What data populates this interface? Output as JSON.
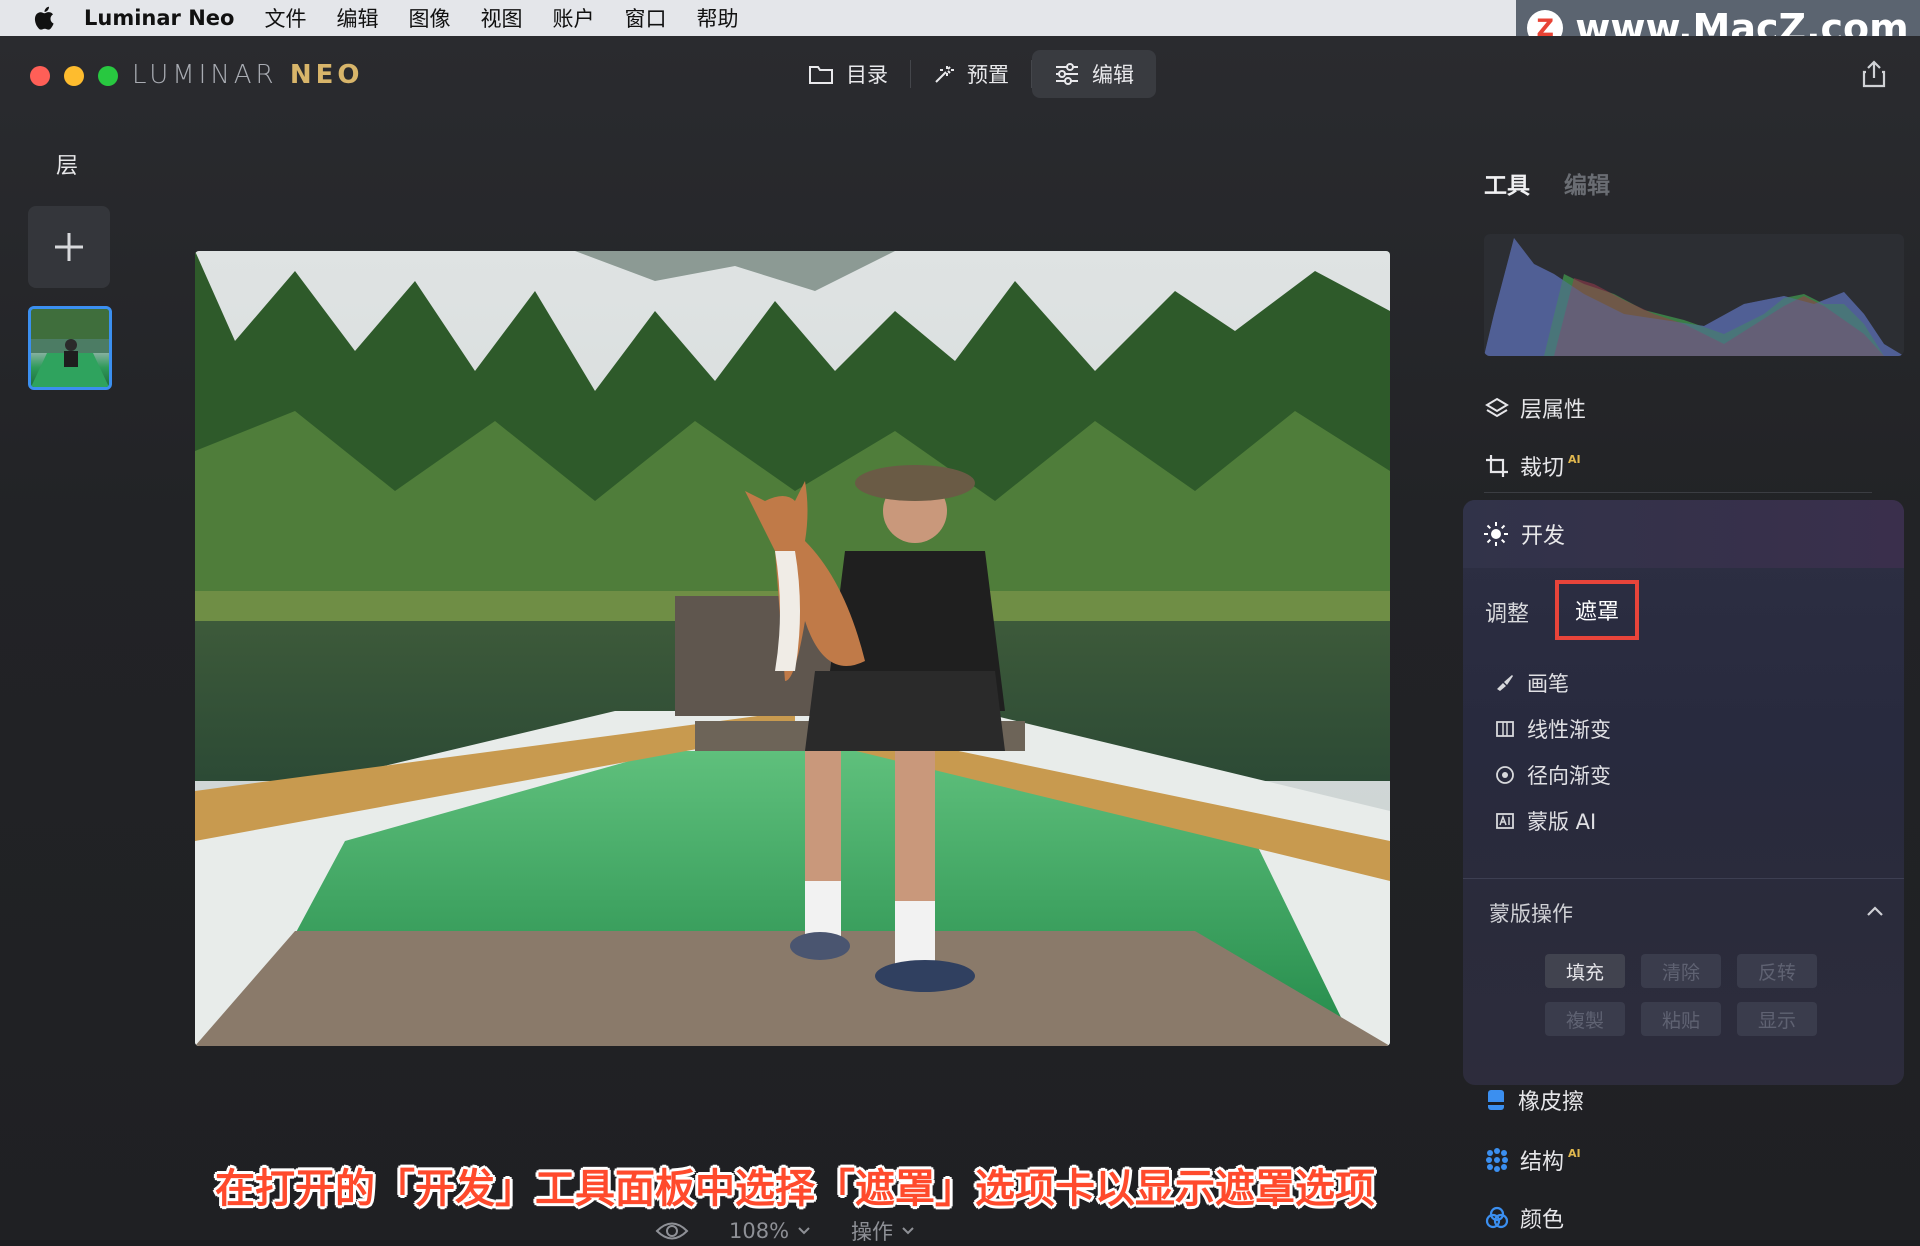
{
  "menubar": {
    "app_name": "Luminar Neo",
    "items": [
      "文件",
      "编辑",
      "图像",
      "视图",
      "账户",
      "窗口",
      "帮助"
    ]
  },
  "watermark": {
    "text": "www.MacZ.com",
    "logo_letter": "Z"
  },
  "app": {
    "brand_main": "LUMINAR ",
    "brand_accent": "NEO",
    "mode_tabs": [
      {
        "label": "目录",
        "icon": "folder-icon"
      },
      {
        "label": "预置",
        "icon": "magic-wand-icon"
      },
      {
        "label": "编辑",
        "icon": "sliders-icon",
        "active": true
      }
    ]
  },
  "layers": {
    "title": "层"
  },
  "right_panel": {
    "tabs": [
      {
        "label": "工具",
        "active": true
      },
      {
        "label": "编辑",
        "active": false
      }
    ],
    "tools_top": [
      {
        "label": "层属性",
        "icon": "layers-icon"
      },
      {
        "label": "裁切",
        "icon": "crop-icon",
        "ai": "AI"
      }
    ],
    "develop": {
      "title": "开发",
      "subtabs": [
        {
          "label": "调整"
        },
        {
          "label": "遮罩",
          "selected": true
        }
      ],
      "mask_tools": [
        {
          "label": "画笔",
          "icon": "brush-icon"
        },
        {
          "label": "线性渐变",
          "icon": "linear-gradient-icon"
        },
        {
          "label": "径向渐变",
          "icon": "radial-gradient-icon"
        },
        {
          "label": "蒙版 AI",
          "icon": "mask-ai-icon"
        }
      ],
      "ops_title": "蒙版操作",
      "ops": [
        {
          "label": "填充",
          "enabled": true
        },
        {
          "label": "清除",
          "enabled": false
        },
        {
          "label": "反转",
          "enabled": false
        },
        {
          "label": "複製",
          "enabled": false
        },
        {
          "label": "粘贴",
          "enabled": false
        },
        {
          "label": "显示",
          "enabled": false
        }
      ]
    },
    "tools_bottom": [
      {
        "label": "橡皮擦",
        "icon": "eraser-icon"
      },
      {
        "label": "结构",
        "icon": "structure-icon",
        "ai": "AI"
      },
      {
        "label": "颜色",
        "icon": "color-icon"
      }
    ]
  },
  "bottom_bar": {
    "zoom": "108%",
    "actions": "操作"
  },
  "caption": "在打开的「开发」工具面板中选择「遮罩」选项卡以显示遮罩选项",
  "colors": {
    "accent_blue": "#3b8ff0",
    "highlight_red": "#e8443a",
    "ai_gold": "#e0b74e"
  }
}
